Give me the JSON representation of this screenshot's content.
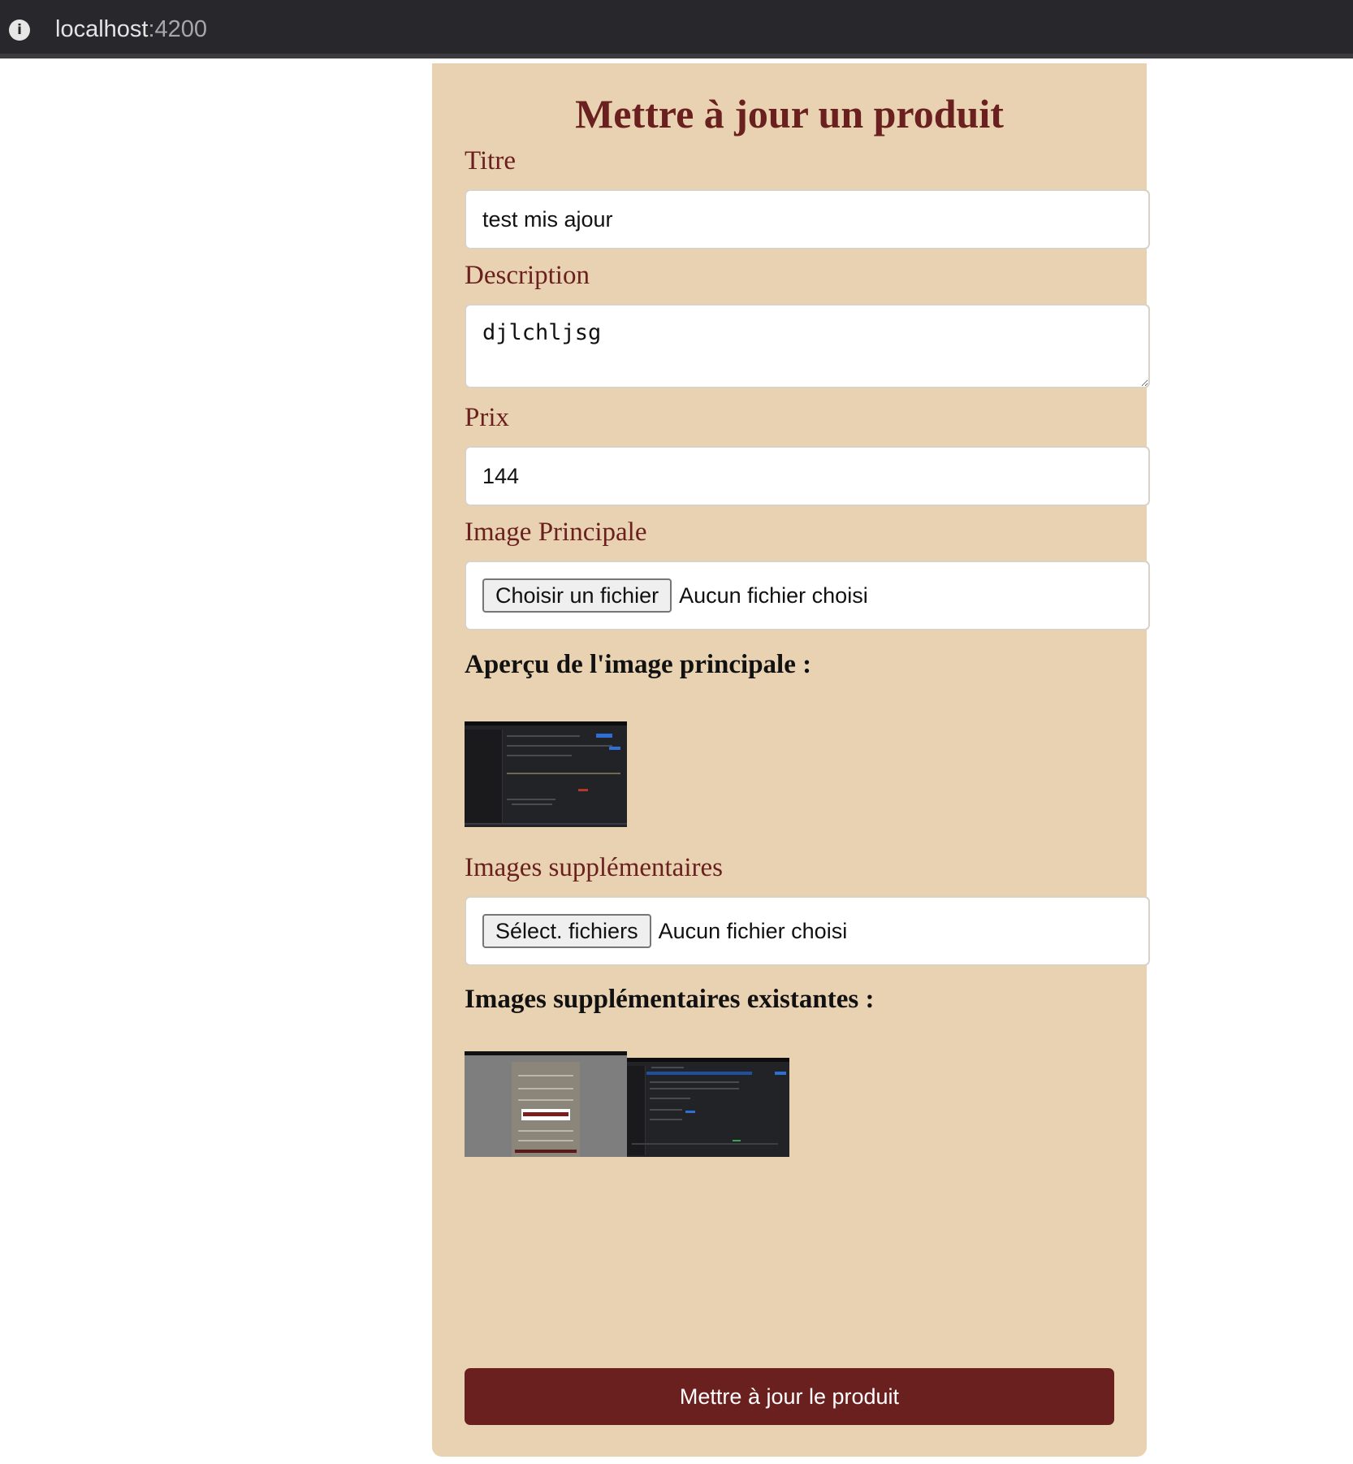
{
  "browser": {
    "url_host": "localhost",
    "url_port": ":4200",
    "info_icon": "info-icon"
  },
  "form": {
    "title": "Mettre à jour un produit",
    "titre_label": "Titre",
    "titre_value": "test mis ajour",
    "description_label": "Description",
    "description_value": "djlchljsg",
    "prix_label": "Prix",
    "prix_value": "144",
    "image_principale_label": "Image Principale",
    "image_principale_button": "Choisir un fichier",
    "image_principale_status": "Aucun fichier choisi",
    "apercu_heading": "Aperçu de l'image principale :",
    "images_supp_label": "Images supplémentaires",
    "images_supp_button": "Sélect. fichiers",
    "images_supp_status": "Aucun fichier choisi",
    "images_existantes_heading": "Images supplémentaires existantes :",
    "submit_label": "Mettre à jour le produit"
  },
  "colors": {
    "card_background": "#e8d2b1",
    "accent": "#6b2020",
    "browser_bar": "#28282c"
  }
}
